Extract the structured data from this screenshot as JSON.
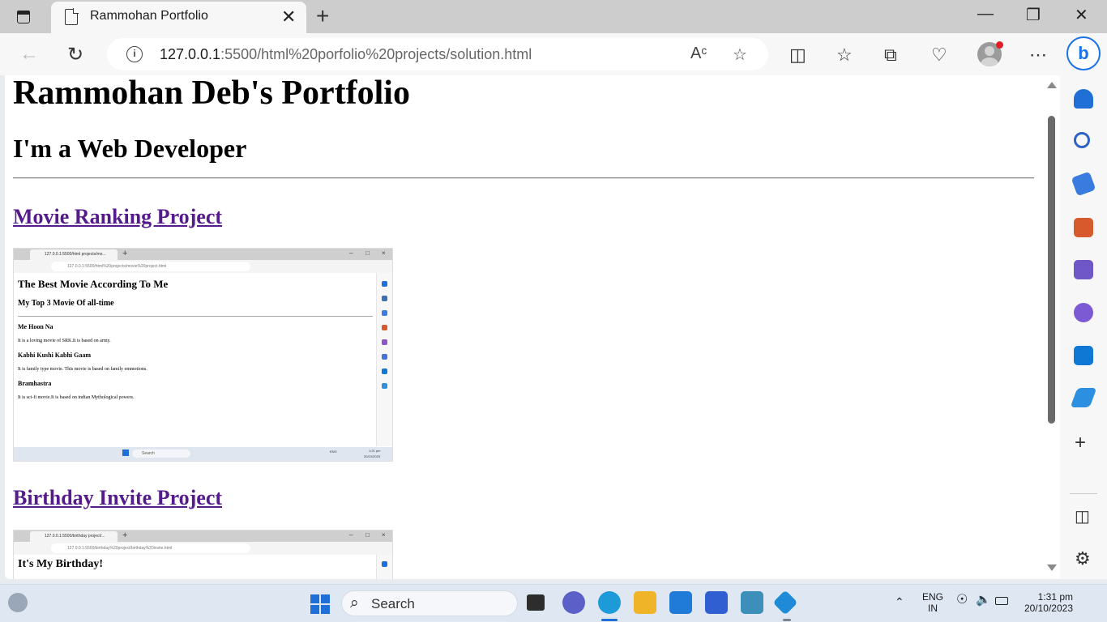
{
  "browser": {
    "tab_title": "Rammohan Portfolio",
    "url_host": "127.0.0.1",
    "url_rest": ":5500/html%20porfolio%20projects/solution.html"
  },
  "page": {
    "title": "Rammohan Deb's Portfolio",
    "subtitle": "I'm a Web Developer",
    "projects": [
      {
        "link": "Movie Ranking Project",
        "thumb": {
          "tab": "127.0.0.1:5500/html projects/mo...",
          "url": "127.0.0.1:5500/html%20projects/movie%20project.html",
          "h1": "The Best Movie According To Me",
          "h2": "My Top 3 Movie Of all-time",
          "items": [
            {
              "name": "Me Hoon Na",
              "desc": "It is a loving movie of SRK.It is based on army."
            },
            {
              "name": "Kabhi Kushi Kabhi Gaam",
              "desc": "It is family type movie. This movie is based on family emmotions."
            },
            {
              "name": "Bramhastra",
              "desc": "It is sci-fi movie.It is based on indian Mythological powers."
            }
          ],
          "taskbar_search": "Search",
          "taskbar_lang": "ENG",
          "taskbar_time": "1:21 pm",
          "taskbar_date": "20/10/2023"
        }
      },
      {
        "link": "Birthday Invite Project",
        "thumb": {
          "tab": "127.0.0.1:5500/birthday project/...",
          "url": "127.0.0.1:5500/birthday%20project/birthday%20invite.html",
          "h1": "It's My Birthday!"
        }
      }
    ]
  },
  "taskbar": {
    "search": "Search",
    "lang1": "ENG",
    "lang2": "IN",
    "time": "1:31 pm",
    "date": "20/10/2023"
  },
  "icons": {
    "new_tab": "+",
    "more": "⋯",
    "refresh": "↻",
    "back": "←",
    "close": "✕",
    "minimize": "—",
    "maximize": "❐",
    "search": "⌕"
  }
}
